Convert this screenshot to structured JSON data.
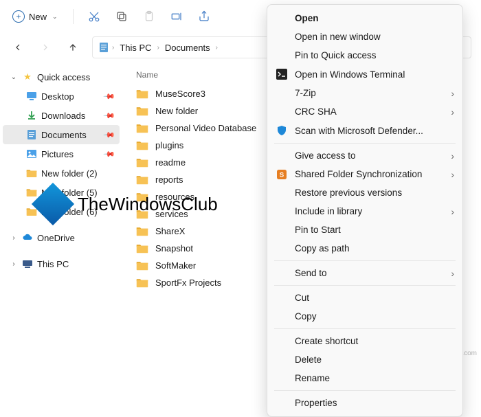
{
  "toolbar": {
    "new_label": "New"
  },
  "breadcrumb": {
    "root": "This PC",
    "current": "Documents"
  },
  "sidebar": {
    "quick_access": "Quick access",
    "items": [
      {
        "label": "Desktop"
      },
      {
        "label": "Downloads"
      },
      {
        "label": "Documents"
      },
      {
        "label": "Pictures"
      },
      {
        "label": "New folder (2)"
      },
      {
        "label": "New folder (5)"
      },
      {
        "label": "New folder (6)"
      }
    ],
    "onedrive": "OneDrive",
    "this_pc": "This PC"
  },
  "content": {
    "header_name": "Name",
    "rows": [
      "MuseScore3",
      "New folder",
      "Personal Video Database",
      "plugins",
      "readme",
      "reports",
      "resources",
      "services",
      "ShareX",
      "Snapshot",
      "SoftMaker",
      "SportFx Projects"
    ]
  },
  "context_menu": {
    "items": [
      {
        "label": "Open",
        "bold": true
      },
      {
        "label": "Open in new window"
      },
      {
        "label": "Pin to Quick access"
      },
      {
        "label": "Open in Windows Terminal",
        "icon": "terminal"
      },
      {
        "label": "7-Zip",
        "submenu": true
      },
      {
        "label": "CRC SHA",
        "submenu": true
      },
      {
        "label": "Scan with Microsoft Defender...",
        "icon": "shield"
      },
      {
        "sep": true
      },
      {
        "label": "Give access to",
        "submenu": true
      },
      {
        "label": "Shared Folder Synchronization",
        "icon": "sync",
        "submenu": true
      },
      {
        "label": "Restore previous versions"
      },
      {
        "label": "Include in library",
        "submenu": true
      },
      {
        "label": "Pin to Start"
      },
      {
        "label": "Copy as path"
      },
      {
        "sep": true
      },
      {
        "label": "Send to",
        "submenu": true
      },
      {
        "sep": true
      },
      {
        "label": "Cut"
      },
      {
        "label": "Copy"
      },
      {
        "sep": true
      },
      {
        "label": "Create shortcut"
      },
      {
        "label": "Delete"
      },
      {
        "label": "Rename"
      },
      {
        "sep": true
      },
      {
        "label": "Properties"
      }
    ]
  },
  "watermark": "TheWindowsClub",
  "corner": "wsxdn.com"
}
